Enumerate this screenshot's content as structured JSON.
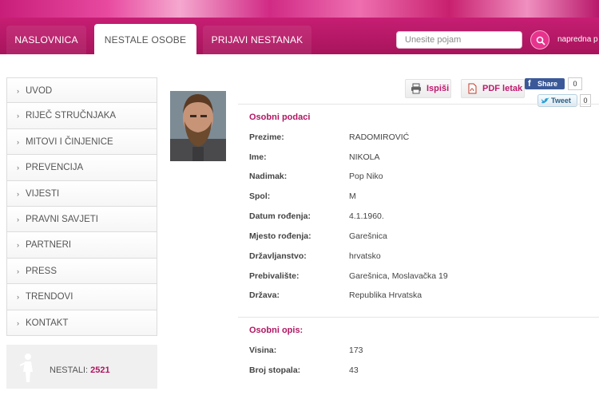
{
  "nav": {
    "tabs": [
      {
        "label": "NASLOVNICA"
      },
      {
        "label": "NESTALE OSOBE"
      },
      {
        "label": "PRIJAVI NESTANAK"
      }
    ],
    "search_placeholder": "Unesite pojam",
    "advanced_search": "napredna p"
  },
  "sidebar": {
    "items": [
      {
        "label": "UVOD"
      },
      {
        "label": "RIJEČ STRUČNJAKA"
      },
      {
        "label": "MITOVI I ČINJENICE"
      },
      {
        "label": "PREVENCIJA"
      },
      {
        "label": "VIJESTI"
      },
      {
        "label": "PRAVNI SAVJETI"
      },
      {
        "label": "PARTNERI"
      },
      {
        "label": "PRESS"
      },
      {
        "label": "TRENDOVI"
      },
      {
        "label": "KONTAKT"
      }
    ],
    "missing_label": "NESTALI:",
    "missing_count": "2521"
  },
  "actions": {
    "print": "Ispiši",
    "pdf": "PDF letak",
    "share": "Share",
    "share_count": "0",
    "tweet": "Tweet",
    "tweet_count": "0"
  },
  "personal": {
    "title": "Osobni podaci",
    "rows": [
      {
        "label": "Prezime:",
        "value": "RADOMIROVIĆ"
      },
      {
        "label": "Ime:",
        "value": "NIKOLA"
      },
      {
        "label": "Nadimak:",
        "value": "Pop Niko"
      },
      {
        "label": "Spol:",
        "value": "M"
      },
      {
        "label": "Datum rođenja:",
        "value": "4.1.1960."
      },
      {
        "label": "Mjesto rođenja:",
        "value": "Garešnica"
      },
      {
        "label": "Državljanstvo:",
        "value": "hrvatsko"
      },
      {
        "label": "Prebivalište:",
        "value": "Garešnica, Moslavačka 19"
      },
      {
        "label": "Država:",
        "value": "Republika Hrvatska"
      }
    ]
  },
  "description": {
    "title": "Osobni opis:",
    "rows": [
      {
        "label": "Visina:",
        "value": "173"
      },
      {
        "label": "Broj stopala:",
        "value": "43"
      }
    ]
  },
  "colors": {
    "brand": "#c61e73",
    "accent": "#b01662"
  }
}
